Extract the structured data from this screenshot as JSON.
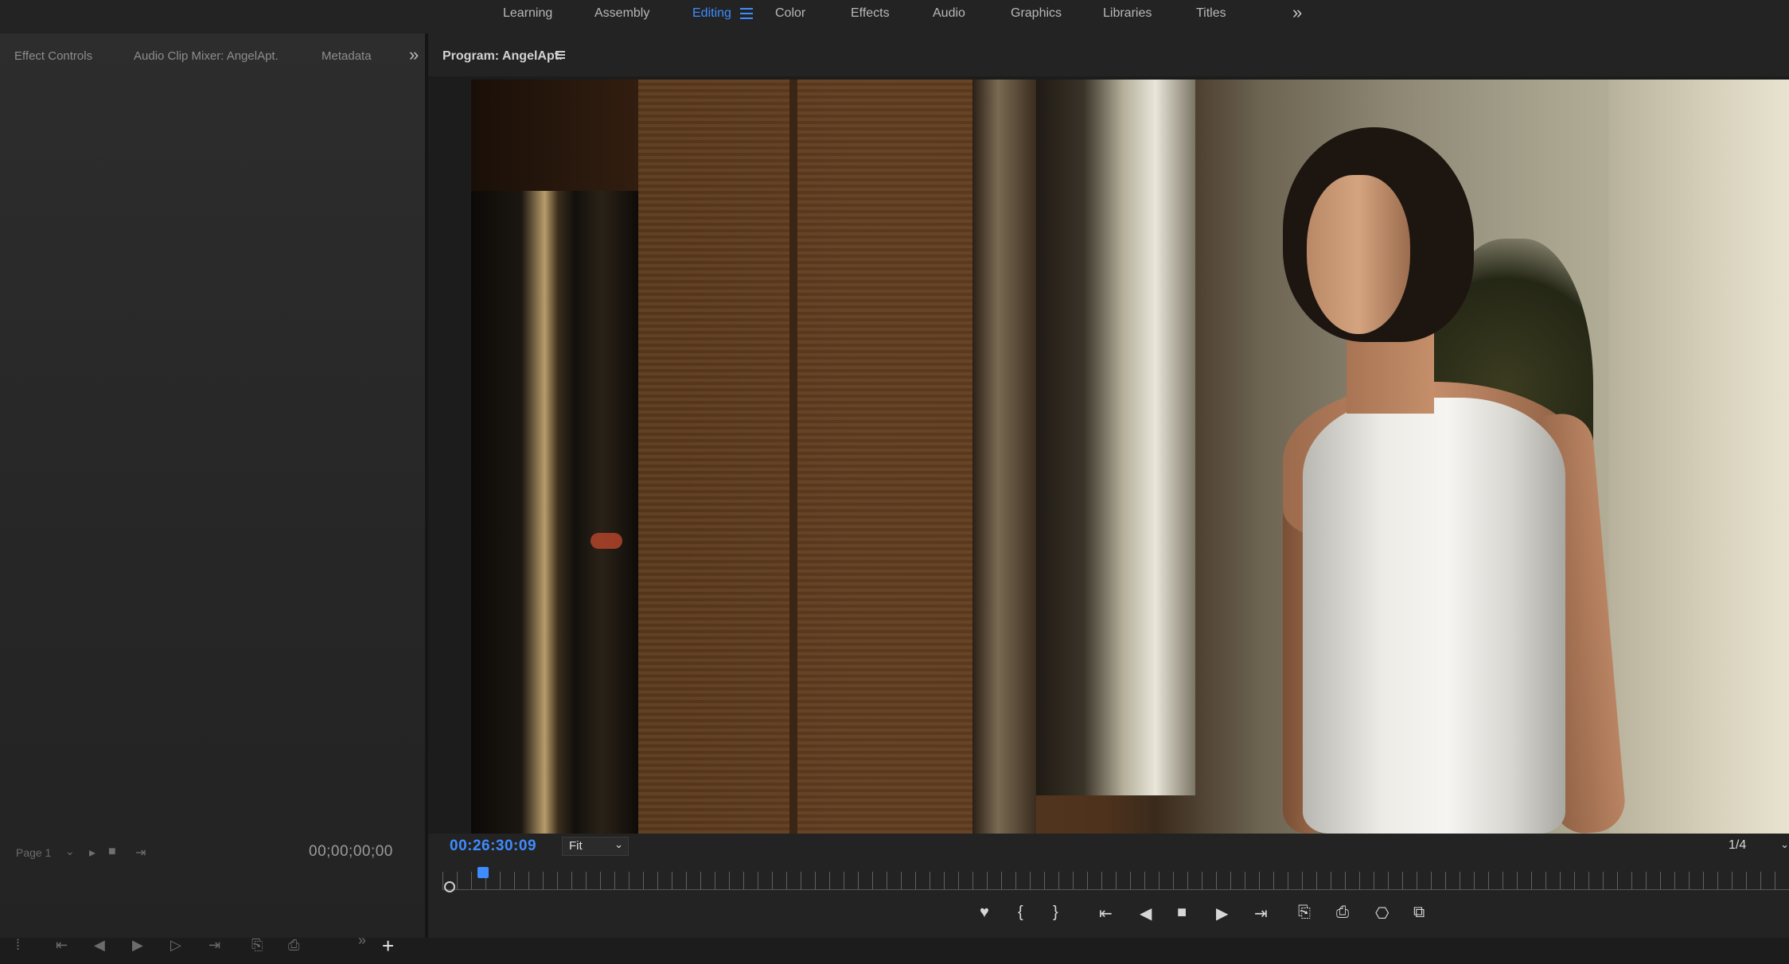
{
  "workspaces": {
    "tabs": [
      {
        "label": "Learning"
      },
      {
        "label": "Assembly"
      },
      {
        "label": "Editing"
      },
      {
        "label": "Color"
      },
      {
        "label": "Effects"
      },
      {
        "label": "Audio"
      },
      {
        "label": "Graphics"
      },
      {
        "label": "Libraries"
      },
      {
        "label": "Titles"
      }
    ],
    "active": "Editing",
    "more_icon": "double-chevron-right-icon"
  },
  "left_panel": {
    "tabs": [
      {
        "label": "Effect Controls"
      },
      {
        "label": "Audio Clip Mixer: AngelApt."
      },
      {
        "label": "Metadata"
      }
    ],
    "page_label": "Page 1",
    "timecode": "00;00;00;00"
  },
  "program_monitor": {
    "title": "Program: AngelApt.",
    "timecode": "00:26:30:09",
    "zoom": "Fit",
    "resolution": "1/4",
    "playhead_fraction": 0.03
  },
  "colors": {
    "accent": "#3f8cff",
    "panel_bg": "#232324",
    "text": "#b8b8b8"
  }
}
